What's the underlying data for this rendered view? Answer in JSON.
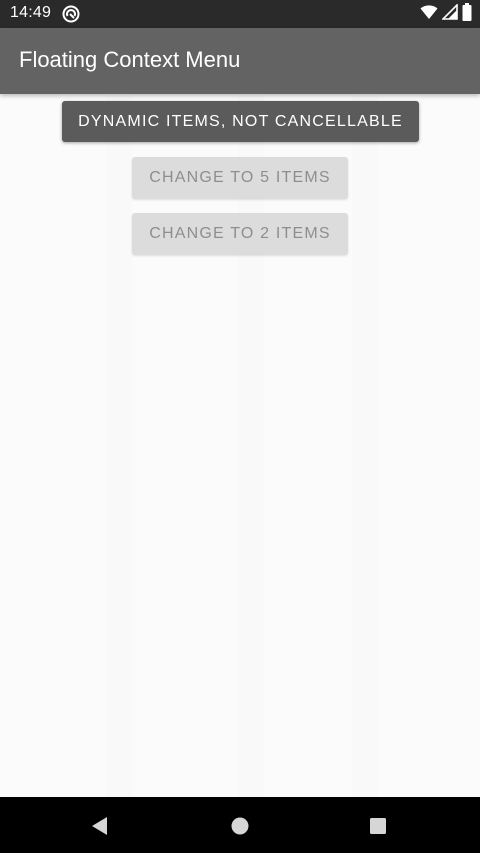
{
  "status_bar": {
    "time": "14:49",
    "icons": [
      "app-notification-icon",
      "wifi-icon",
      "signal-icon",
      "battery-icon"
    ]
  },
  "app_bar": {
    "title": "Floating Context Menu"
  },
  "main": {
    "primary_button": "DYNAMIC ITEMS, NOT CANCELLABLE",
    "button_five": "CHANGE TO 5 ITEMS",
    "button_two": "CHANGE TO 2 ITEMS"
  },
  "nav_bar": {
    "icons": [
      "back-icon",
      "home-icon",
      "recents-icon"
    ]
  },
  "colors": {
    "status_bar_bg": "#2a2a2a",
    "app_bar_bg": "#636363",
    "primary_button_bg": "#5b5b5b",
    "secondary_button_bg": "#dcdcdc",
    "secondary_button_text": "#8e8e8e",
    "nav_bar_bg": "#000000"
  }
}
